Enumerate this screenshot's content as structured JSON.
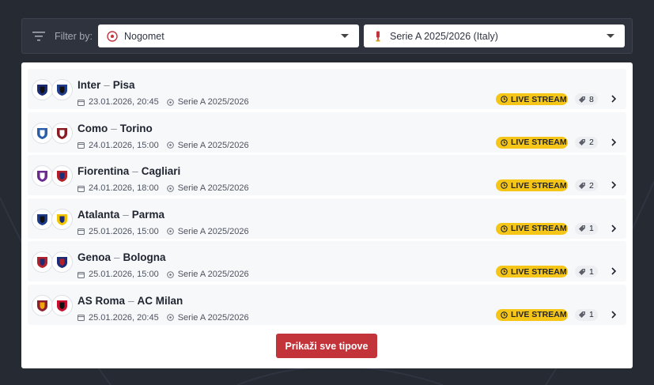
{
  "filter": {
    "label": "Filter by:",
    "sport": {
      "value": "Nogomet",
      "icon": "soccer-ball-icon"
    },
    "league": {
      "value": "Serie A 2025/2026 (Italy)",
      "icon": "trophy-icon"
    }
  },
  "matches": [
    {
      "home": "Inter",
      "away": "Pisa",
      "date": "23.01.2026, 20:45",
      "competition": "Serie A 2025/2026",
      "badge": "LIVE STREAM",
      "tips": "8",
      "home_colors": [
        "#1a2b78",
        "#111111"
      ],
      "away_colors": [
        "#1f3d8c",
        "#111111"
      ]
    },
    {
      "home": "Como",
      "away": "Torino",
      "date": "24.01.2026, 15:00",
      "competition": "Serie A 2025/2026",
      "badge": "LIVE STREAM",
      "tips": "2",
      "home_colors": [
        "#2b5fa8",
        "#ffffff"
      ],
      "away_colors": [
        "#8a1c24",
        "#ffffff"
      ]
    },
    {
      "home": "Fiorentina",
      "away": "Cagliari",
      "date": "24.01.2026, 18:00",
      "competition": "Serie A 2025/2026",
      "badge": "LIVE STREAM",
      "tips": "2",
      "home_colors": [
        "#6a2c91",
        "#ffffff"
      ],
      "away_colors": [
        "#b3202a",
        "#1a2b78"
      ]
    },
    {
      "home": "Atalanta",
      "away": "Parma",
      "date": "25.01.2026, 15:00",
      "competition": "Serie A 2025/2026",
      "badge": "LIVE STREAM",
      "tips": "1",
      "home_colors": [
        "#1d3a8a",
        "#111111"
      ],
      "away_colors": [
        "#f2c500",
        "#1a2b78"
      ]
    },
    {
      "home": "Genoa",
      "away": "Bologna",
      "date": "25.01.2026, 15:00",
      "competition": "Serie A 2025/2026",
      "badge": "LIVE STREAM",
      "tips": "1",
      "home_colors": [
        "#b3202a",
        "#1a2b78"
      ],
      "away_colors": [
        "#1a2b78",
        "#b3202a"
      ]
    },
    {
      "home": "AS Roma",
      "away": "AC Milan",
      "date": "25.01.2026, 20:45",
      "competition": "Serie A 2025/2026",
      "badge": "LIVE STREAM",
      "tips": "1",
      "home_colors": [
        "#8e1f2f",
        "#f0a500"
      ],
      "away_colors": [
        "#c8102e",
        "#111111"
      ]
    }
  ],
  "show_all_label": "Prikaži sve tipove",
  "colors": {
    "accent": "#c2343a",
    "live": "#f5c518",
    "background": "#262a33"
  }
}
